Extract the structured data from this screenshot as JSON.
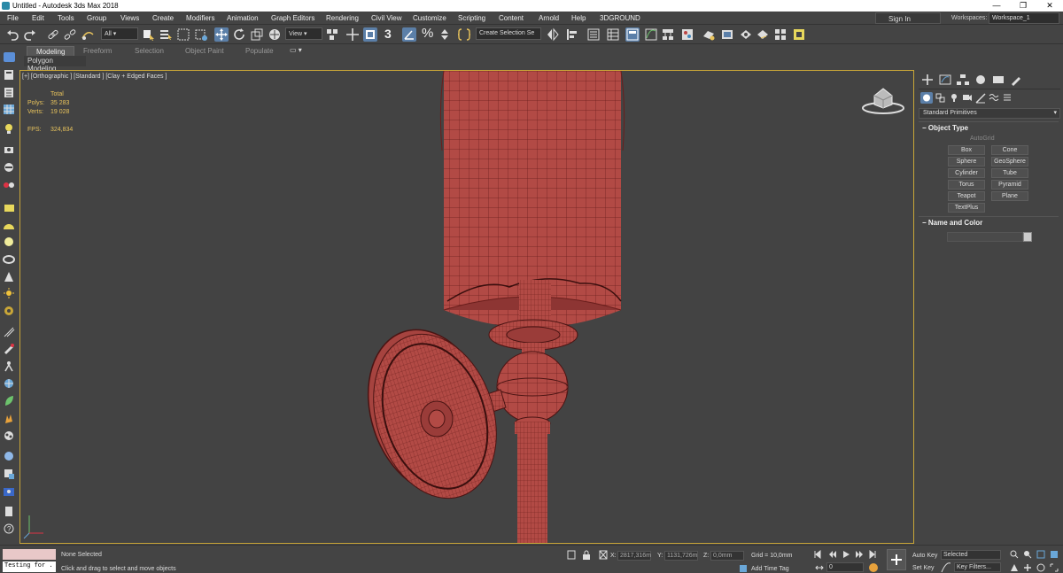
{
  "titlebar": {
    "title": "Untitled - Autodesk 3ds Max 2018",
    "minimize": "—",
    "maximize": "❐",
    "close": "✕"
  },
  "menu": [
    "File",
    "Edit",
    "Tools",
    "Group",
    "Views",
    "Create",
    "Modifiers",
    "Animation",
    "Graph Editors",
    "Rendering",
    "Civil View",
    "Customize",
    "Scripting",
    "Content",
    "Arnold",
    "Help",
    "3DGROUND"
  ],
  "account": {
    "signin": "Sign In",
    "workspaces_label": "Workspaces:",
    "workspace": "Workspace_1"
  },
  "toolbar": {
    "selection_filter": "All",
    "ref_coord": "View",
    "selection_set": "Create Selection Se",
    "snap_angle": "3",
    "percent": "%"
  },
  "ribbon": {
    "tabs": [
      "Modeling",
      "Freeform",
      "Selection",
      "Object Paint",
      "Populate"
    ],
    "active": "Modeling",
    "panel": "Polygon Modeling"
  },
  "viewport": {
    "label": "[+] [Orthographic ] [Standard ] [Clay + Edged Faces ]",
    "stats": {
      "total_label": "Total",
      "polys_label": "Polys:",
      "polys": "35 283",
      "verts_label": "Verts:",
      "verts": "19 028",
      "fps_label": "FPS:",
      "fps": "324,834"
    },
    "mesh_color": "#b24a45"
  },
  "command_panel": {
    "category": "Standard Primitives",
    "object_type": "Object Type",
    "autogrid": "AutoGrid",
    "primitives": [
      "Box",
      "Cone",
      "Sphere",
      "GeoSphere",
      "Cylinder",
      "Tube",
      "Torus",
      "Pyramid",
      "Teapot",
      "Plane",
      "TextPlus"
    ],
    "name_color": "Name and Color"
  },
  "status": {
    "maxscript": "Testing for .",
    "selection": "None Selected",
    "prompt": "Click and drag to select and move objects",
    "x_label": "X:",
    "x": "2817,316m",
    "y_label": "Y:",
    "y": "1131,726m",
    "z_label": "Z:",
    "z": "0,0mm",
    "grid": "Grid = 10,0mm",
    "add_time_tag": "Add Time Tag",
    "frame": "0",
    "auto_key": "Auto Key",
    "set_key": "Set Key",
    "key_mode": "Selected",
    "key_filters": "Key Filters..."
  }
}
